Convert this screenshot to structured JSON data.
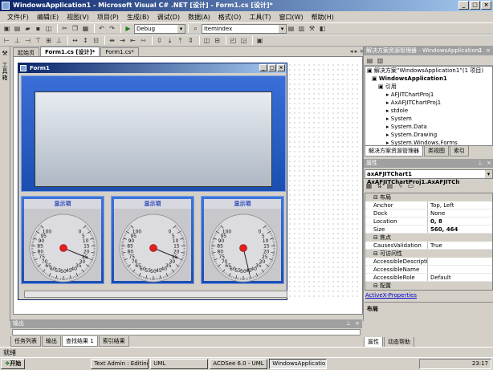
{
  "window": {
    "title": "WindowsApplication1 - Microsoft Visual C# .NET [设计] - Form1.cs [设计]*"
  },
  "menu": [
    "文件(F)",
    "编辑(E)",
    "视图(V)",
    "项目(P)",
    "生成(B)",
    "调试(D)",
    "数据(A)",
    "格式(O)",
    "工具(T)",
    "窗口(W)",
    "帮助(H)"
  ],
  "toolbar": {
    "config_value": "Debug",
    "find_value": "ItemIndex"
  },
  "tabs": [
    {
      "label": "起始页"
    },
    {
      "label": "Form1.cs [设计]*"
    },
    {
      "label": "Form1.cs*"
    }
  ],
  "form": {
    "title": "Form1"
  },
  "gauges": [
    {
      "label": "显示项",
      "value": 25
    },
    {
      "label": "显示项",
      "value": 25
    },
    {
      "label": "显示项",
      "value": 45
    }
  ],
  "gauge_ticks": [
    "0",
    "5",
    "10",
    "15",
    "20",
    "25",
    "30",
    "35",
    "40",
    "45",
    "50",
    "55",
    "60",
    "65",
    "70",
    "75",
    "80",
    "85",
    "90",
    "95",
    "100"
  ],
  "solution": {
    "title": "解决方案资源管理器 - WindowsApplication1",
    "items": [
      "解决方案“WindowsApplication1”(1 项目)",
      "WindowsApplication1",
      "引用",
      "AFJITChartProj1",
      "AxAFJITChartProj1",
      "stdole",
      "System",
      "System.Data",
      "System.Drawing",
      "System.Windows.Forms"
    ],
    "tabs": [
      "解决方案资源管理器",
      "类视图",
      "索引"
    ]
  },
  "properties": {
    "title": "属性",
    "object": "axAFJITChart1  AxAFJITChartProj1.AxAFJITCh",
    "rows": [
      {
        "cat": "布局"
      },
      {
        "name": "Anchor",
        "value": "Top, Left"
      },
      {
        "name": "Dock",
        "value": "None"
      },
      {
        "name": "Location",
        "value": "0, 8"
      },
      {
        "name": "Size",
        "value": "560, 464"
      },
      {
        "cat": "焦点"
      },
      {
        "name": "CausesValidation",
        "value": "True"
      },
      {
        "cat": "可访问性"
      },
      {
        "name": "AccessibleDescription",
        "value": ""
      },
      {
        "name": "AccessibleName",
        "value": ""
      },
      {
        "name": "AccessibleRole",
        "value": "Default"
      },
      {
        "cat": "配置"
      }
    ],
    "link": "ActiveX-Properties",
    "desc_title": "布局",
    "tabs": [
      "属性",
      "动态帮助"
    ]
  },
  "output": {
    "title": "输出",
    "tabs": [
      "任务列表",
      "输出",
      "查找结果 1",
      "索引结果"
    ]
  },
  "status": {
    "text": "就绪"
  },
  "taskbar": {
    "start": "开始",
    "tasks": [
      "Text Admin : Editing...",
      "UML",
      "ACDSee 6.0 - UML",
      "WindowsApplicatio..."
    ],
    "clock": "23:17"
  }
}
